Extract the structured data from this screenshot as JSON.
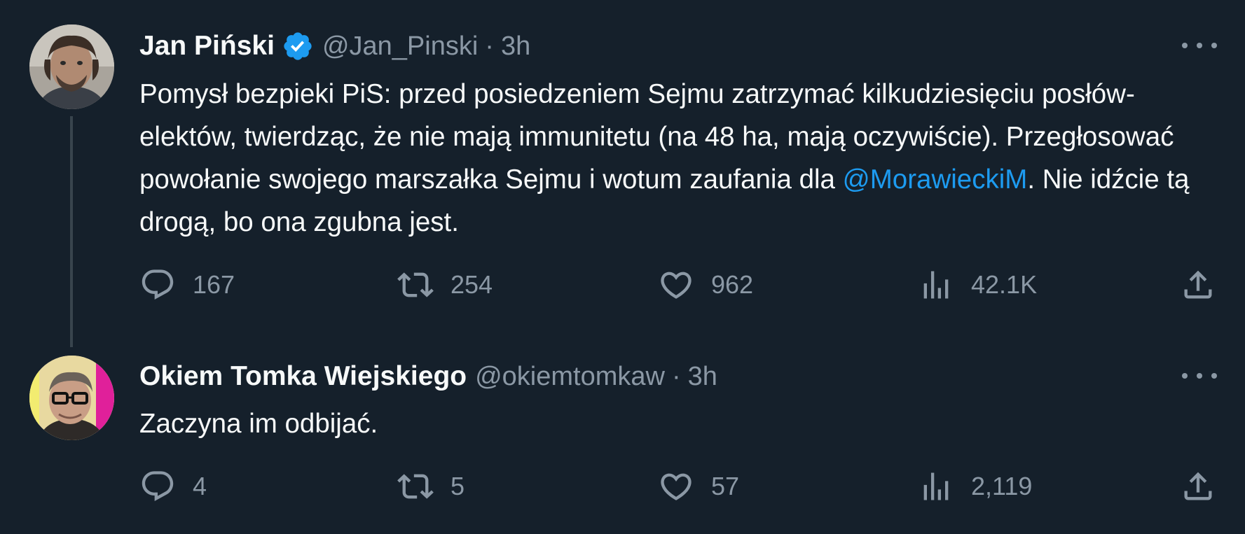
{
  "tweets": [
    {
      "display_name": "Jan Piński",
      "verified": true,
      "handle": "@Jan_Pinski",
      "separator": "·",
      "time": "3h",
      "text_before_mention": "Pomysł bezpieki PiS: przed posiedzeniem Sejmu zatrzymać kilkudziesięciu posłów-elektów, twierdząc, że nie mają immunitetu (na 48 ha, mają oczywiście). Przegłosować powołanie swojego marszałka Sejmu i wotum zaufania dla ",
      "mention": "@MorawieckiM",
      "text_after_mention": ". Nie idźcie tą drogą, bo ona zgubna jest.",
      "replies": "167",
      "retweets": "254",
      "likes": "962",
      "views": "42.1K"
    },
    {
      "display_name": "Okiem Tomka Wiejskiego",
      "verified": false,
      "handle": "@okiemtomkaw",
      "separator": "·",
      "time": "3h",
      "text": "Zaczyna im odbijać.",
      "replies": "4",
      "retweets": "5",
      "likes": "57",
      "views": "2,119"
    }
  ],
  "icons": {
    "reply": "reply-icon",
    "retweet": "retweet-icon",
    "like": "heart-icon",
    "views": "views-bar-chart-icon",
    "share": "share-icon",
    "more": "more-horizontal-icon",
    "verified": "verified-badge-icon"
  },
  "colors": {
    "background": "#15202b",
    "text": "#f7f9f9",
    "secondary": "#8b98a5",
    "link": "#1d9bf0",
    "thread_line": "#38444d"
  }
}
